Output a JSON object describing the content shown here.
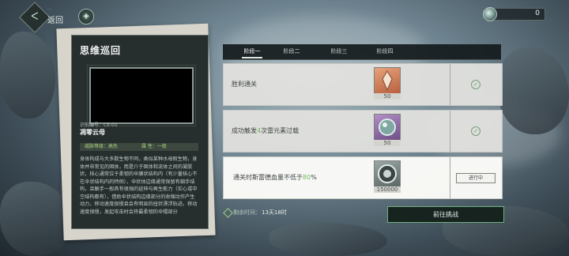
{
  "header": {
    "subtitle": "···",
    "title": "返回",
    "back_icon": "back-arrow-icon",
    "currency": {
      "amount": "0",
      "icon": "coin-icon"
    }
  },
  "card": {
    "title": "思维巡回",
    "id_label": "识别编号：CE-01",
    "name": "凋零云母",
    "threat": "威胁等级：高危",
    "attribute": "属 性：一般",
    "description": "身体构成与大多数生物不同，类似某种水母假生物，身体并非常见的固体，而是介于固体和流体之间的凝胶状，核心通常位于柔韧的伞膜状结构内（有少量核心不在伞状结构内的特例），伞状体边缘通常保留有细手结构，且触手一般具有很强的延伸与再生能力（实心或中空结构都有），借助伞状结构边缘部分的收缩动作产生动力，移动速度很慢且会有明显的扭状漂浮轨迹。移动速度很慢，发起攻击时会将最柔韧的伞帽部分"
  },
  "tabs": [
    {
      "label": "阶段一",
      "active": true
    },
    {
      "label": "阶段二",
      "active": false
    },
    {
      "label": "阶段三",
      "active": false
    },
    {
      "label": "阶段四",
      "active": false
    }
  ],
  "tasks": [
    {
      "text": "胜利通关",
      "reward_count": "50",
      "status": "completed"
    },
    {
      "text_before": "成功触发",
      "text_highlight": "4",
      "text_after": "次雷元素过载",
      "reward_count": "50",
      "status": "completed"
    },
    {
      "text_before": "通关时斯雷德血量不低于",
      "text_highlight": "80",
      "text_after": "%",
      "reward_count": "150000",
      "status": "in_progress",
      "status_label": "进行中"
    }
  ],
  "footer": {
    "time_label": "剩余时间：",
    "time_value": "13天18时",
    "go_button": "前往挑战"
  },
  "colors": {
    "accent_green": "#6fb85a",
    "panel_dark": "#1f2628"
  }
}
